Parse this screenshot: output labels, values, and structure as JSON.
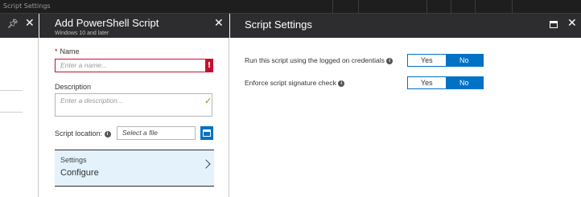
{
  "window": {
    "title": "Script Settings"
  },
  "blade_add": {
    "title": "Add PowerShell Script",
    "subtitle": "Windows 10 and later",
    "name": {
      "label": "Name",
      "required_mark": "*",
      "placeholder": "Enter a name...",
      "error_icon": "!"
    },
    "description": {
      "label": "Description",
      "placeholder": "Enter a description...",
      "valid_icon": "✓"
    },
    "script_location": {
      "label": "Script location:",
      "info_icon": "i",
      "value": "Select a file"
    },
    "settings": {
      "title": "Settings",
      "value": "Configure"
    }
  },
  "blade_settings": {
    "title": "Script Settings",
    "rows": [
      {
        "label": "Run this script using the logged on credentials",
        "info_icon": "i",
        "options": [
          "Yes",
          "No"
        ],
        "selected": "No"
      },
      {
        "label": "Enforce script signature check",
        "info_icon": "i",
        "options": [
          "Yes",
          "No"
        ],
        "selected": "No"
      }
    ]
  },
  "colors": {
    "accent": "#0072c6",
    "error": "#c8102e",
    "header": "#2d2d30",
    "settings_bg": "#e3f2fb"
  },
  "icons": [
    "pin-icon",
    "close-icon",
    "error-icon",
    "check-icon",
    "info-icon",
    "browse-file-icon",
    "chevron-right-icon",
    "maximize-icon"
  ]
}
